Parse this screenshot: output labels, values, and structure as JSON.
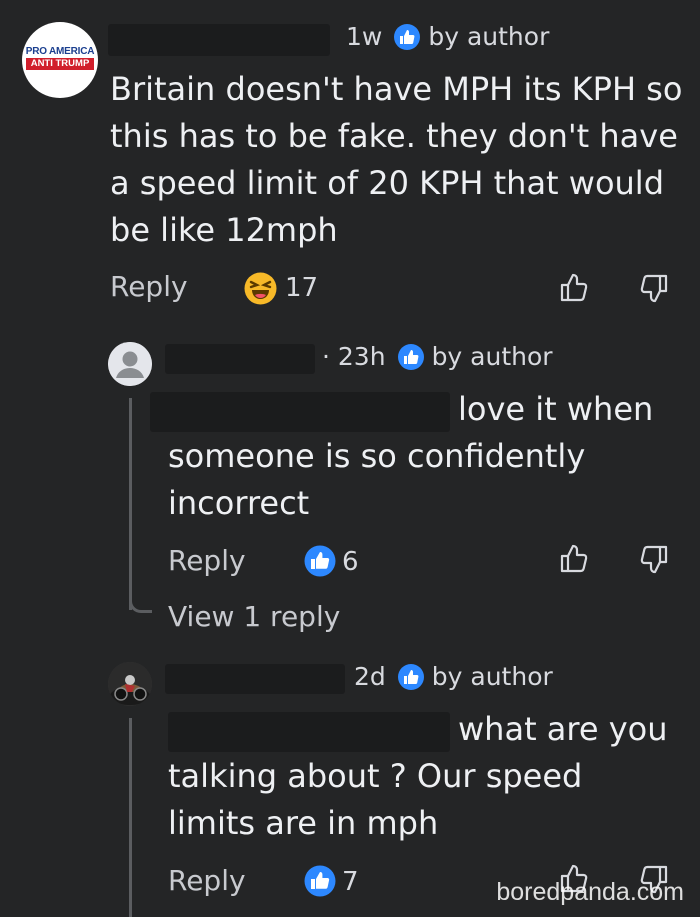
{
  "comments": [
    {
      "avatar_text_line1": "PRO AMERICA",
      "avatar_text_line2": "ANTI TRUMP",
      "time": "1w",
      "author_tag": "by author",
      "body": "Britain doesn't have MPH its KPH so this has to be fake. they don't have a speed limit of 20 KPH that would be like 12mph",
      "reply_label": "Reply",
      "reaction_count": "17",
      "reaction_icon": "laugh-reaction-icon"
    },
    {
      "time": "· 23h",
      "author_tag": "by author",
      "body_line1": "love it when",
      "body_rest": "someone is so confidently incorrect",
      "reply_label": "Reply",
      "reaction_count": "6",
      "reaction_icon": "like-reaction-icon",
      "view_replies": "View 1 reply"
    },
    {
      "time": "2d",
      "author_tag": "by author",
      "body_line1": "what are you",
      "body_rest": "talking about ? Our speed limits are in mph",
      "reply_label": "Reply",
      "reaction_count": "7",
      "reaction_icon": "like-reaction-icon"
    }
  ],
  "watermark": "boredpanda.com",
  "colors": {
    "background": "#242526",
    "accent_blue": "#2d88ff",
    "laugh_yellow": "#f7b928"
  }
}
